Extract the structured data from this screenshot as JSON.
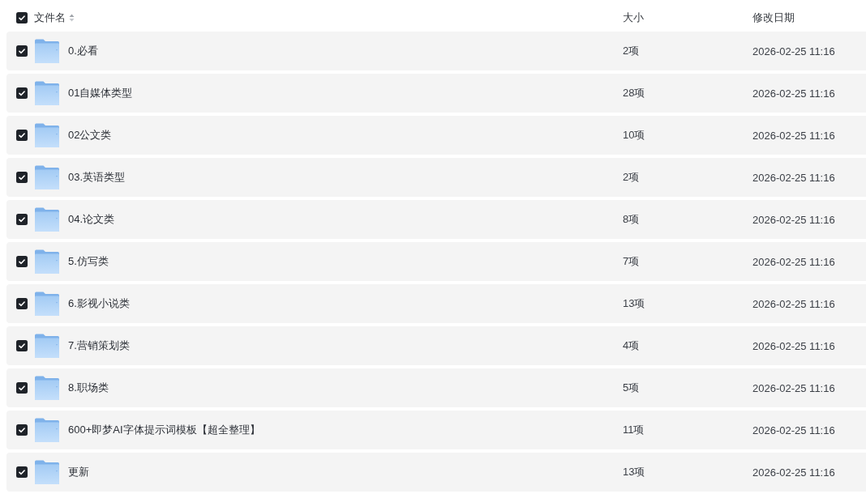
{
  "table": {
    "select_all": {
      "checked": true
    },
    "columns": [
      {
        "label": "文件名",
        "sortable": true
      },
      {
        "label": "大小",
        "sortable": false
      },
      {
        "label": "修改日期",
        "sortable": false
      }
    ],
    "rows": [
      {
        "name": "0.必看",
        "size": "2项",
        "modified": "2026-02-25 11:16",
        "checked": true
      },
      {
        "name": "01自媒体类型",
        "size": "28项",
        "modified": "2026-02-25 11:16",
        "checked": true
      },
      {
        "name": "02公文类",
        "size": "10项",
        "modified": "2026-02-25 11:16",
        "checked": true
      },
      {
        "name": "03.英语类型",
        "size": "2项",
        "modified": "2026-02-25 11:16",
        "checked": true
      },
      {
        "name": "04.论文类",
        "size": "8项",
        "modified": "2026-02-25 11:16",
        "checked": true
      },
      {
        "name": "5.仿写类",
        "size": "7项",
        "modified": "2026-02-25 11:16",
        "checked": true
      },
      {
        "name": "6.影视小说类",
        "size": "13项",
        "modified": "2026-02-25 11:16",
        "checked": true
      },
      {
        "name": "7.营销策划类",
        "size": "4项",
        "modified": "2026-02-25 11:16",
        "checked": true
      },
      {
        "name": "8.职场类",
        "size": "5项",
        "modified": "2026-02-25 11:16",
        "checked": true
      },
      {
        "name": "600+即梦AI字体提示词模板【超全整理】",
        "size": "11项",
        "modified": "2026-02-25 11:16",
        "checked": true
      },
      {
        "name": "更新",
        "size": "13项",
        "modified": "2026-02-25 11:16",
        "checked": true
      }
    ]
  }
}
